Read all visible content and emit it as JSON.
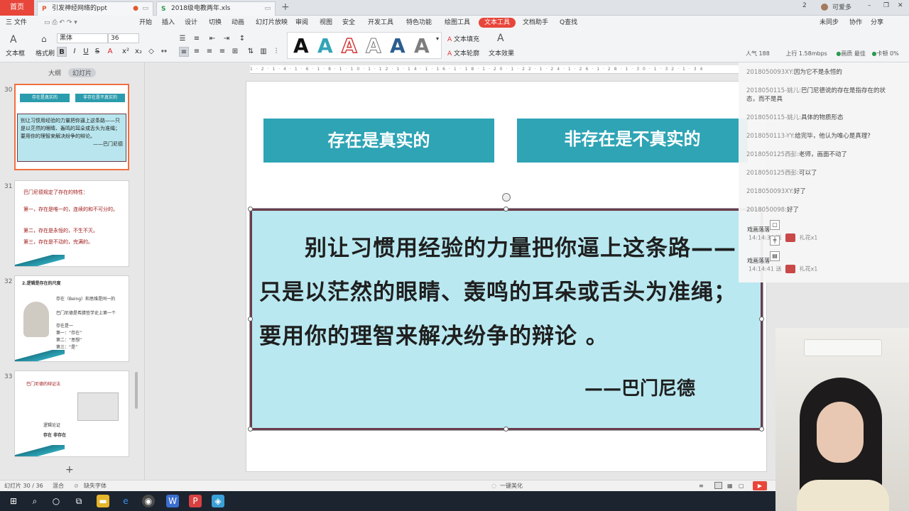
{
  "tabs": {
    "home": "首页",
    "doc1": "引发神经网络的ppt",
    "doc2": "2018级电教两年.xls",
    "new_tab": "+"
  },
  "window_right": {
    "badge": "2",
    "user": "可爱多",
    "min": "–",
    "max": "❐",
    "close": "✕"
  },
  "menu": {
    "file": "三 文件",
    "items": [
      "开始",
      "插入",
      "设计",
      "切换",
      "动画",
      "幻灯片放映",
      "审阅",
      "视图",
      "安全",
      "开发工具",
      "特色功能",
      "绘图工具"
    ],
    "active": "文本工具",
    "after": [
      "文档助手",
      "Q查找"
    ],
    "right": [
      "未同步",
      "协作",
      "分享"
    ]
  },
  "ribbon": {
    "text_box": "文本框",
    "format_painter": "格式刷",
    "font": "黑体",
    "size": "36",
    "text_fill": "文本填充",
    "text_outline": "文本轮廓",
    "text_effect": "文本效果"
  },
  "left_pane": {
    "tab_outline": "大纲",
    "tab_slides": "幻灯片",
    "slides": [
      {
        "num": "30",
        "a": "存在是真实的",
        "b": "非存在是不真实的",
        "quote": "别让习惯用经验的力量把你逼上这条路——只是以茫然的眼睛、轰鸣的耳朵或舌头为准绳；要用你的理智来解决纷争的辩论。",
        "author": "——巴门尼德"
      },
      {
        "num": "31",
        "lines": [
          "巴门尼德规定了存在的特性：",
          "第一，存在是唯一的，连续的和不可分的。",
          "第二，存在是永恒的，不生不灭。",
          "第三，存在是不动的，完满的。"
        ]
      },
      {
        "num": "32",
        "title": "2.逻辑是存在的尺度",
        "lines": [
          "存在（Being）和思维是同一的",
          "巴门尼德是希腊哲学史上第一个",
          "存在是一",
          "第一：“存在”",
          "第二：“思想”",
          "第三：“是”"
        ]
      },
      {
        "num": "33",
        "lines": [
          "巴门尼德的辩证法",
          "逻辑论证",
          "存在 非存在"
        ]
      }
    ]
  },
  "slide": {
    "box1": "存在是真实的",
    "box2": "非存在是不真实的",
    "quote": "　　别让习惯用经验的力量把你逼上这条路——只是以茫然的眼睛、轰鸣的耳朵或舌头为准绳；要用你的理智来解决纷争的辩论 。",
    "author": "——巴门尼德"
  },
  "ruler": "1·2·1·4·1·6·1·8·1·10·1·12·1·14·1·16·1·18·1·20·1·22·1·24·1·26·1·28·1·30·1·32·1·34",
  "chat": {
    "stats": {
      "viewers": "人气 188",
      "upload": "上行 1.58mbps",
      "quality": "画质 最佳",
      "cpu": "卡顿 0%"
    },
    "messages": [
      {
        "name": "2018050093XY:",
        "text": "因为它不是永恒的"
      },
      {
        "name": "2018050115-姚儿:",
        "text": "巴门尼德说的存在是指存在的状态，而不是具"
      },
      {
        "name": "2018050115-姚儿:",
        "text": "具体的物质形态"
      },
      {
        "name": "2018050113-YY:",
        "text": "给完毕，他认为唯心是真理?"
      },
      {
        "name": "2018050125西彭:",
        "text": "老师，画面不动了"
      },
      {
        "name": "2018050125西彭:",
        "text": "可以了"
      },
      {
        "name": "2018050093XY:",
        "text": "好了"
      },
      {
        "name": "2018050098:",
        "text": "好了"
      }
    ],
    "gifts": [
      {
        "user": "戏画落落",
        "time": "14:14:34",
        "action": "送",
        "item": "礼花x1"
      },
      {
        "user": "戏画落落",
        "time": "14:14:41",
        "action": "送",
        "item": "礼花x1"
      }
    ]
  },
  "status": {
    "slide_count": "幻灯片 30 / 36",
    "theme": "混合",
    "missing_font": "缺失字体",
    "beautify": "一键美化"
  },
  "colors": {
    "accent": "#e8463b",
    "teal": "#2ea4b5",
    "quote_bg": "#b9e8f0",
    "quote_border": "#6b3d4c"
  }
}
